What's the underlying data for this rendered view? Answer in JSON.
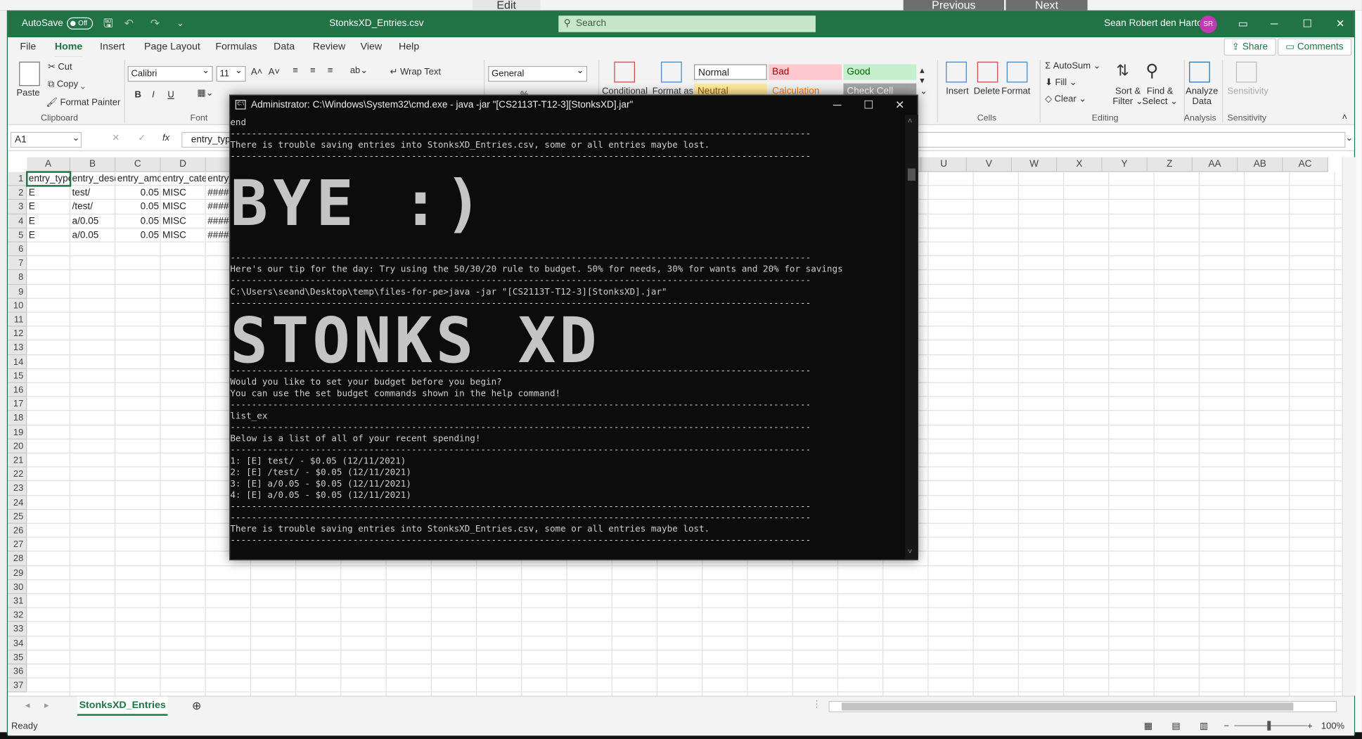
{
  "background": {
    "prev_label": "Previous",
    "next_label": "Next",
    "edit_label": "Edit"
  },
  "excel": {
    "title": {
      "autosave": "AutoSave",
      "toggle": "Off",
      "filename": "StonksXD_Entries.csv",
      "search_placeholder": "Search",
      "user": "Sean Robert den Hartog",
      "initials": "SR"
    },
    "tabs": [
      "File",
      "Home",
      "Insert",
      "Page Layout",
      "Formulas",
      "Data",
      "Review",
      "View",
      "Help"
    ],
    "share_label": "Share",
    "comments_label": "Comments",
    "ribbon": {
      "paste": "Paste",
      "cut": "Cut",
      "copy": "Copy",
      "format_painter": "Format Painter",
      "clipboard_group": "Clipboard",
      "font_name": "Calibri",
      "font_size": "11",
      "bold": "B",
      "italic": "I",
      "underline": "U",
      "font_group": "Font",
      "wrap_text": "Wrap Text",
      "number_format": "General",
      "conditional": "Conditional",
      "format_as": "Format as",
      "styles": {
        "normal": "Normal",
        "bad": "Bad",
        "good": "Good",
        "neutral": "Neutral",
        "calculation": "Calculation",
        "check_cell": "Check Cell"
      },
      "insert": "Insert",
      "delete": "Delete",
      "format": "Format",
      "cells_group": "Cells",
      "autosum": "AutoSum",
      "fill": "Fill",
      "clear": "Clear",
      "sort_filter_1": "Sort &",
      "sort_filter_2": "Filter",
      "find_select_1": "Find &",
      "find_select_2": "Select",
      "editing_group": "Editing",
      "analyze_1": "Analyze",
      "analyze_2": "Data",
      "analysis_group": "Analysis",
      "sensitivity": "Sensitivity",
      "sensitivity_group": "Sensitivity"
    },
    "formula_bar": {
      "namebox": "A1",
      "fx": "fx",
      "content": "entry_type"
    },
    "columns": [
      "A",
      "B",
      "C",
      "D",
      "E",
      "U",
      "V",
      "W",
      "X",
      "Y",
      "Z",
      "AA",
      "AB",
      "AC"
    ],
    "rows": [
      "1",
      "2",
      "3",
      "4",
      "5",
      "6",
      "7",
      "8",
      "9",
      "10",
      "11",
      "12",
      "13",
      "14",
      "15",
      "16",
      "17",
      "18",
      "19",
      "20",
      "21",
      "22",
      "23",
      "24",
      "25",
      "26",
      "27",
      "28",
      "29",
      "30",
      "31",
      "32",
      "33",
      "34",
      "35",
      "36",
      "37"
    ],
    "sheet_rows": [
      [
        "entry_type",
        "entry_description",
        "entry_amount",
        "entry_category",
        "entry_date"
      ],
      [
        "E",
        "test/",
        "0.05",
        "MISC",
        "########"
      ],
      [
        "E",
        "/test/",
        "0.05",
        "MISC",
        "########"
      ],
      [
        "E",
        "a/0.05",
        "0.05",
        "MISC",
        "########"
      ],
      [
        "E",
        "a/0.05",
        "0.05",
        "MISC",
        "########"
      ]
    ],
    "sheet_tab": "StonksXD_Entries",
    "status": "Ready",
    "zoom": "100%"
  },
  "cmd": {
    "title": "Administrator: C:\\Windows\\System32\\cmd.exe - java  -jar \"[CS2113T-T12-3][StonksXD].jar\"",
    "lines": [
      "end",
      "-------------------------------------------------------------------------------------------------------------",
      "There is trouble saving entries into StonksXD_Entries.csv, some or all entries maybe lost.",
      "-------------------------------------------------------------------------------------------------------------",
      "-------------------------------------------------------------------------------------------------------------",
      "Here's our tip for the day: Try using the 50/30/20 rule to budget. 50% for needs, 30% for wants and 20% for savings",
      "-------------------------------------------------------------------------------------------------------------",
      "C:\\Users\\seand\\Desktop\\temp\\files-for-pe>java -jar \"[CS2113T-T12-3][StonksXD].jar\"",
      "-------------------------------------------------------------------------------------------------------------",
      "-------------------------------------------------------------------------------------------------------------",
      "Would you like to set your budget before you begin?",
      "You can use the set budget commands shown in the help command!",
      "-------------------------------------------------------------------------------------------------------------",
      "list_ex",
      "-------------------------------------------------------------------------------------------------------------",
      "Below is a list of all of your recent spending!",
      "-------------------------------------------------------------------------------------------------------------",
      "1: [E] test/ - $0.05 (12/11/2021)",
      "2: [E] /test/ - $0.05 (12/11/2021)",
      "3: [E] a/0.05 - $0.05 (12/11/2021)",
      "4: [E] a/0.05 - $0.05 (12/11/2021)",
      "-------------------------------------------------------------------------------------------------------------",
      "-------------------------------------------------------------------------------------------------------------",
      "There is trouble saving entries into StonksXD_Entries.csv, some or all entries maybe lost.",
      "-------------------------------------------------------------------------------------------------------------"
    ],
    "banner_bye": "BYE :)",
    "banner_stonks": "STONKS XD"
  },
  "colors": {
    "excel_green": "#217346",
    "console_bg": "#0c0c0c",
    "console_text": "#cccccc",
    "style_bad": "#ffc7ce",
    "style_good": "#c6efce",
    "style_neutral": "#ffeb9c"
  }
}
